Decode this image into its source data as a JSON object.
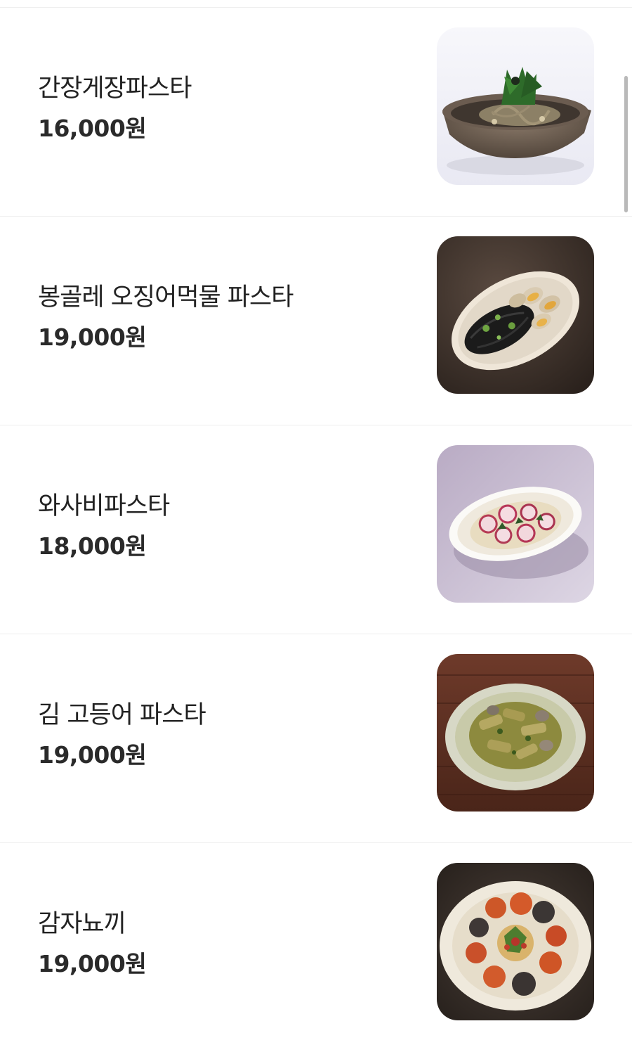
{
  "menu": {
    "items": [
      {
        "name": "간장게장파스타",
        "price": "16,000원",
        "image": "soy-crab-pasta-photo"
      },
      {
        "name": "봉골레 오징어먹물 파스타",
        "price": "19,000원",
        "image": "squid-ink-vongole-photo"
      },
      {
        "name": "와사비파스타",
        "price": "18,000원",
        "image": "wasabi-pasta-photo"
      },
      {
        "name": "김 고등어 파스타",
        "price": "19,000원",
        "image": "seaweed-mackerel-pasta-photo"
      },
      {
        "name": "감자뇨끼",
        "price": "19,000원",
        "image": "potato-gnocchi-photo"
      }
    ]
  },
  "colors": {
    "text": "#222222",
    "divider": "#ededed",
    "scrollbar": "#b9b9b9"
  }
}
